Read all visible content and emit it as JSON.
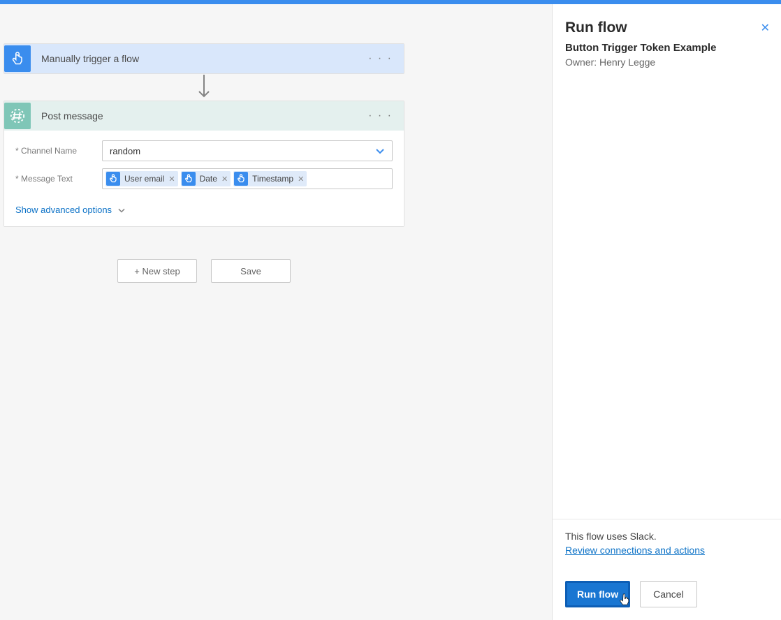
{
  "trigger": {
    "title": "Manually trigger a flow",
    "icon": "tap-icon"
  },
  "action": {
    "title": "Post message",
    "icon": "hash-icon",
    "fields": {
      "channel_label": "* Channel Name",
      "channel_value": "random",
      "message_label": "* Message Text",
      "tokens": [
        {
          "label": "User email"
        },
        {
          "label": "Date"
        },
        {
          "label": "Timestamp"
        }
      ]
    },
    "advanced_label": "Show advanced options"
  },
  "buttons": {
    "new_step": "+ New step",
    "save": "Save"
  },
  "panel": {
    "title": "Run flow",
    "subtitle": "Button Trigger Token Example",
    "owner": "Owner: Henry Legge",
    "info": "This flow uses Slack.",
    "review_link": "Review connections and actions",
    "run": "Run flow",
    "cancel": "Cancel"
  }
}
